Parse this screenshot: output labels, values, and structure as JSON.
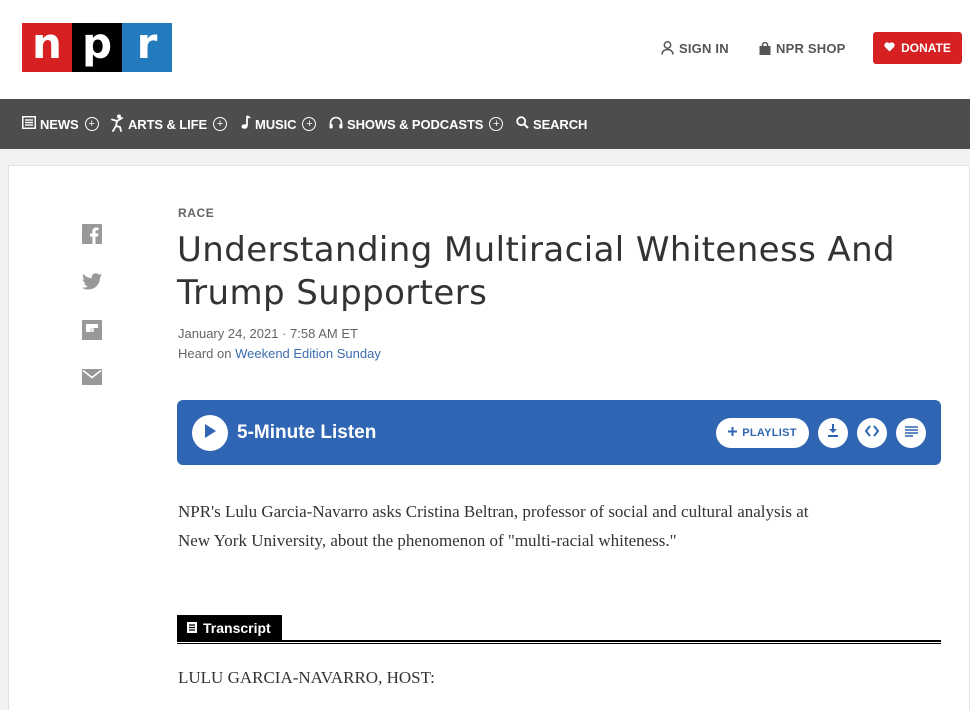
{
  "header": {
    "logo": {
      "letters": [
        "n",
        "p",
        "r"
      ],
      "colors": [
        "#d62021",
        "#000000",
        "#237bbd"
      ]
    },
    "sign_in": "SIGN IN",
    "shop": "NPR SHOP",
    "donate": "DONATE",
    "donate_color": "#d62021"
  },
  "nav": {
    "items": [
      {
        "label": "NEWS",
        "icon": "newspaper-icon",
        "expandable": true
      },
      {
        "label": "ARTS & LIFE",
        "icon": "dancer-icon",
        "expandable": true
      },
      {
        "label": "MUSIC",
        "icon": "music-note-icon",
        "expandable": true
      },
      {
        "label": "SHOWS & PODCASTS",
        "icon": "headphones-icon",
        "expandable": true
      },
      {
        "label": "SEARCH",
        "icon": "search-icon",
        "expandable": false
      }
    ],
    "plus_symbol": "+"
  },
  "share": {
    "icons": [
      "facebook-icon",
      "twitter-icon",
      "flipboard-icon",
      "email-icon"
    ]
  },
  "article": {
    "kicker": "RACE",
    "headline": "Understanding Multiracial Whiteness And Trump Supporters",
    "date": "January 24, 2021 · 7:58 AM ET",
    "heard_on_prefix": "Heard on ",
    "heard_on_show": "Weekend Edition Sunday",
    "teaser": "NPR's Lulu Garcia-Navarro asks Cristina Beltran, professor of social and cultural analysis at New York University, about the phenomenon of \"multi-racial whiteness.\""
  },
  "player": {
    "title": "5-Minute Listen",
    "playlist_label": "PLAYLIST",
    "accent": "#2f65b3"
  },
  "transcript": {
    "tab_label": "Transcript",
    "first_line": "LULU GARCIA-NAVARRO, HOST:"
  }
}
